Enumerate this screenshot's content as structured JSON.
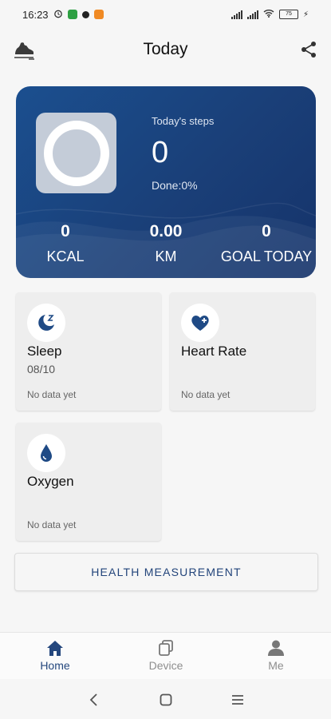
{
  "status_bar": {
    "time": "16:23",
    "battery": "75"
  },
  "header": {
    "title": "Today"
  },
  "steps_card": {
    "label": "Today's steps",
    "steps": "0",
    "done": "Done:0%",
    "stats": [
      {
        "value": "0",
        "label": "KCAL"
      },
      {
        "value": "0.00",
        "label": "KM"
      },
      {
        "value": "0",
        "label": "GOAL TODAY"
      }
    ]
  },
  "tiles": {
    "sleep": {
      "title": "Sleep",
      "date": "08/10",
      "status": "No data yet",
      "icon": "moon-icon"
    },
    "heart_rate": {
      "title": "Heart Rate",
      "status": "No data yet",
      "icon": "heart-plus-icon"
    },
    "oxygen": {
      "title": "Oxygen",
      "status": "No data yet",
      "icon": "drop-icon"
    }
  },
  "health_button": {
    "label": "HEALTH MEASUREMENT"
  },
  "bottom_nav": {
    "items": [
      {
        "label": "Home",
        "icon": "home-icon",
        "active": true
      },
      {
        "label": "Device",
        "icon": "device-icon",
        "active": false
      },
      {
        "label": "Me",
        "icon": "person-icon",
        "active": false
      }
    ]
  },
  "colors": {
    "accent": "#24477d",
    "card": "#1a3f78"
  }
}
